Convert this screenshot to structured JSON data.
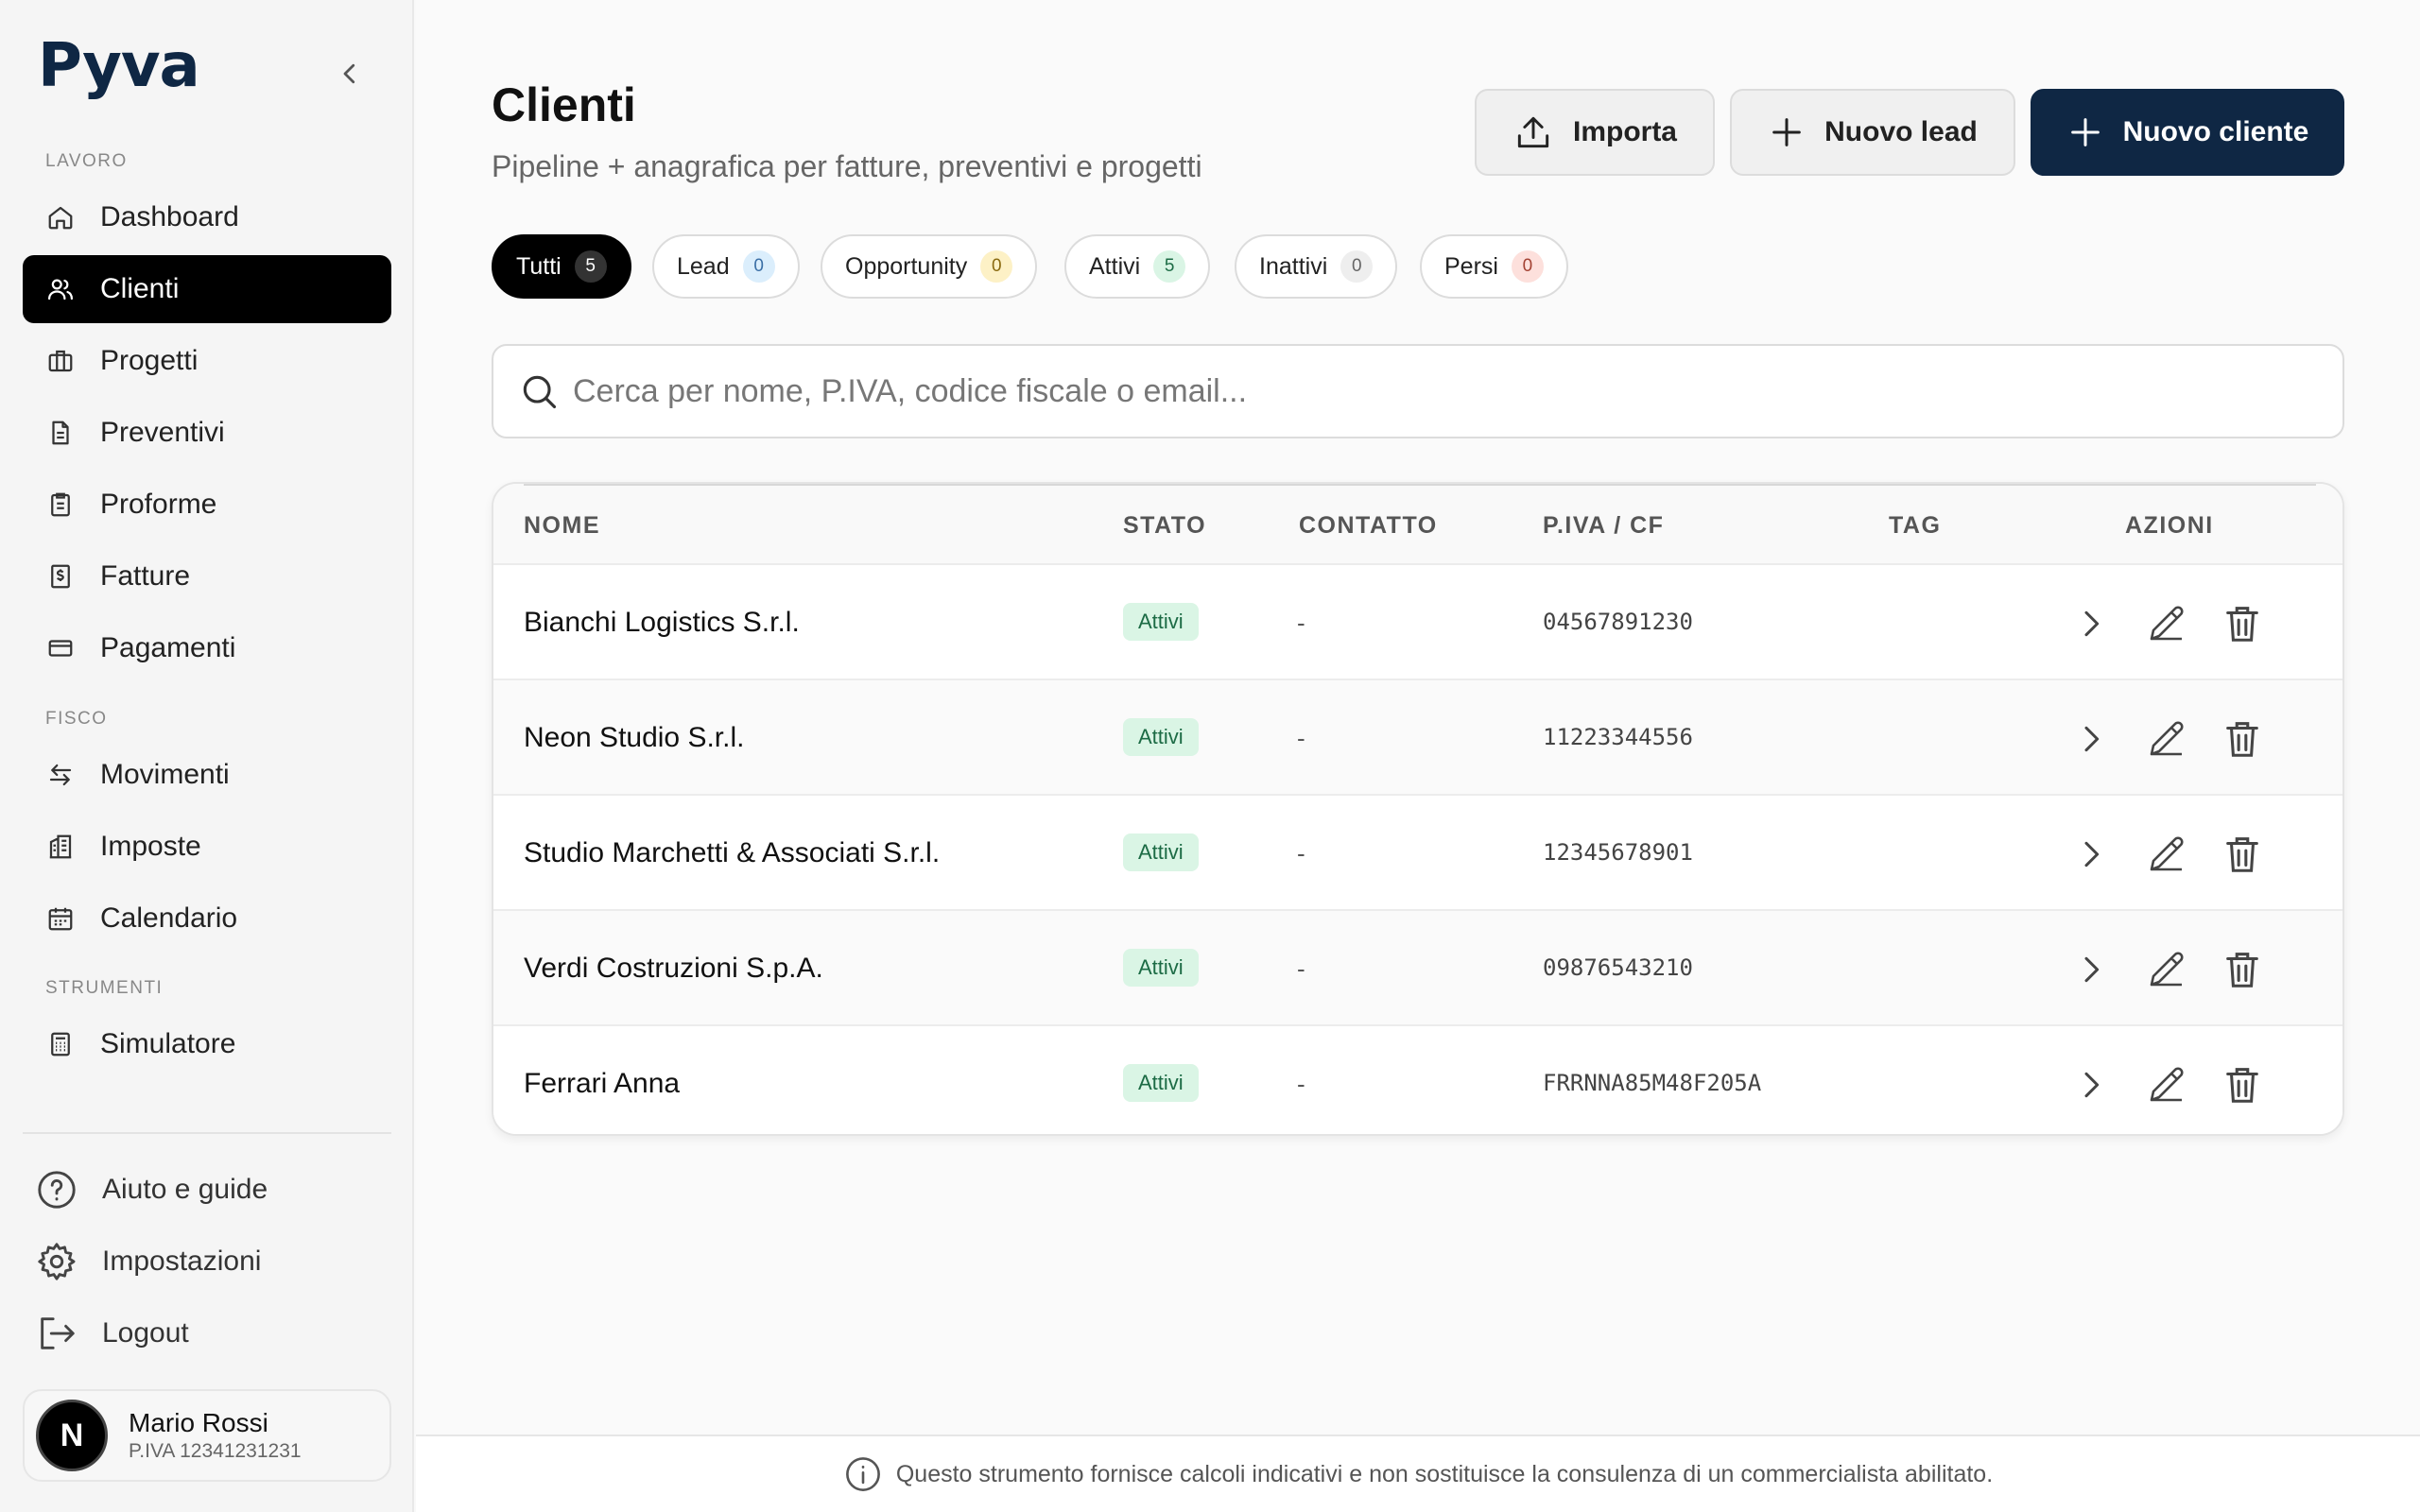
{
  "app": {
    "logo": "Pyva"
  },
  "sidebar": {
    "sections": {
      "lavoro": "LAVORO",
      "fisco": "FISCO",
      "strumenti": "STRUMENTI"
    },
    "items": [
      {
        "label": "Dashboard",
        "icon": "home-icon"
      },
      {
        "label": "Clienti",
        "icon": "users-icon",
        "active": true
      },
      {
        "label": "Progetti",
        "icon": "briefcase-icon"
      },
      {
        "label": "Preventivi",
        "icon": "document-icon"
      },
      {
        "label": "Proforme",
        "icon": "clipboard-icon"
      },
      {
        "label": "Fatture",
        "icon": "invoice-icon"
      },
      {
        "label": "Pagamenti",
        "icon": "credit-card-icon"
      },
      {
        "label": "Movimenti",
        "icon": "arrows-icon"
      },
      {
        "label": "Imposte",
        "icon": "building-icon"
      },
      {
        "label": "Calendario",
        "icon": "calendar-icon"
      },
      {
        "label": "Simulatore",
        "icon": "calculator-icon"
      }
    ],
    "bottom": [
      {
        "label": "Aiuto e guide",
        "icon": "help-icon"
      },
      {
        "label": "Impostazioni",
        "icon": "gear-icon"
      },
      {
        "label": "Logout",
        "icon": "logout-icon"
      }
    ],
    "user": {
      "initial": "N",
      "name": "Mario Rossi",
      "piva": "P.IVA 12341231231"
    }
  },
  "header": {
    "title": "Clienti",
    "subtitle": "Pipeline + anagrafica per fatture, preventivi e progetti",
    "buttons": {
      "import": "Importa",
      "new_lead": "Nuovo lead",
      "new_client": "Nuovo cliente"
    }
  },
  "filters": [
    {
      "label": "Tutti",
      "count": "5",
      "active": true,
      "badge_bg": "#333333",
      "badge_fg": "#ffffff"
    },
    {
      "label": "Lead",
      "count": "0",
      "badge_bg": "#dbeefc",
      "badge_fg": "#3b6fa6"
    },
    {
      "label": "Opportunity",
      "count": "0",
      "badge_bg": "#fdf1c6",
      "badge_fg": "#8a6a10"
    },
    {
      "label": "Attivi",
      "count": "5",
      "badge_bg": "#daf5e5",
      "badge_fg": "#1c6b45"
    },
    {
      "label": "Inattivi",
      "count": "0",
      "badge_bg": "#eeeeee",
      "badge_fg": "#666666"
    },
    {
      "label": "Persi",
      "count": "0",
      "badge_bg": "#fde0dc",
      "badge_fg": "#a34233"
    }
  ],
  "search": {
    "placeholder": "Cerca per nome, P.IVA, codice fiscale o email..."
  },
  "table": {
    "headers": {
      "nome": "NOME",
      "stato": "STATO",
      "contatto": "CONTATTO",
      "piva": "P.IVA / CF",
      "tag": "TAG",
      "azioni": "AZIONI"
    },
    "rows": [
      {
        "name": "Bianchi Logistics S.r.l.",
        "status": "Attivi",
        "contact": "-",
        "piva": "04567891230"
      },
      {
        "name": "Neon Studio S.r.l.",
        "status": "Attivi",
        "contact": "-",
        "piva": "11223344556"
      },
      {
        "name": "Studio Marchetti & Associati S.r.l.",
        "status": "Attivi",
        "contact": "-",
        "piva": "12345678901"
      },
      {
        "name": "Verdi Costruzioni S.p.A.",
        "status": "Attivi",
        "contact": "-",
        "piva": "09876543210"
      },
      {
        "name": "Ferrari Anna",
        "status": "Attivi",
        "contact": "-",
        "piva": "FRRNNA85M48F205A"
      }
    ]
  },
  "footer": {
    "disclaimer": "Questo strumento fornisce calcoli indicativi e non sostituisce la consulenza di un commercialista abilitato."
  },
  "colors": {
    "brand": "#0f2744",
    "active_nav": "#000000",
    "status_active_bg": "#daf5e5"
  }
}
